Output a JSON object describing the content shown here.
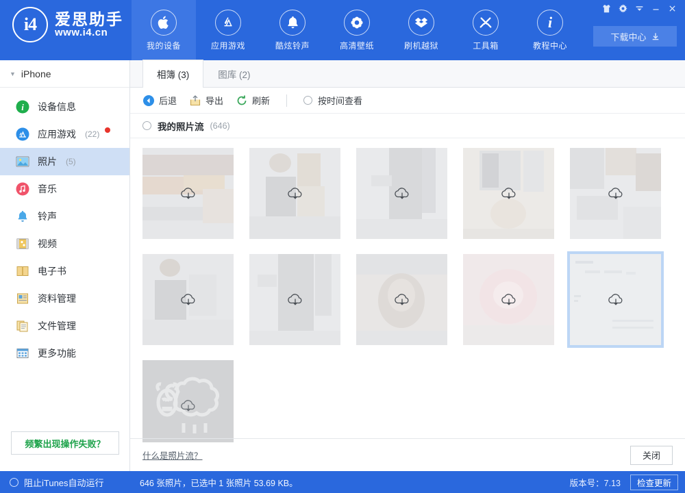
{
  "brand": {
    "name_cn": "爱思助手",
    "url": "www.i4.cn",
    "logo_text": "i4"
  },
  "topnav": {
    "items": [
      {
        "label": "我的设备",
        "icon": "apple-icon",
        "active": true
      },
      {
        "label": "应用游戏",
        "icon": "appstore-icon",
        "active": false
      },
      {
        "label": "酷炫铃声",
        "icon": "bell-icon",
        "active": false
      },
      {
        "label": "高清壁纸",
        "icon": "flower-icon",
        "active": false
      },
      {
        "label": "刷机越狱",
        "icon": "open-box-icon",
        "active": false
      },
      {
        "label": "工具箱",
        "icon": "tools-icon",
        "active": false
      },
      {
        "label": "教程中心",
        "icon": "info-icon",
        "active": false
      }
    ],
    "download_center": "下载中心",
    "window_controls": [
      "shirt-icon",
      "gear-icon",
      "menu-icon",
      "minimize-icon",
      "close-icon"
    ]
  },
  "sidebar": {
    "device": "iPhone",
    "items": [
      {
        "label": "设备信息",
        "count": "",
        "icon": "info-circle-icon",
        "active": false,
        "badge": false
      },
      {
        "label": "应用游戏",
        "count": "(22)",
        "icon": "appstore-circle-icon",
        "active": false,
        "badge": true
      },
      {
        "label": "照片",
        "count": "(5)",
        "icon": "photo-icon",
        "active": true,
        "badge": false
      },
      {
        "label": "音乐",
        "count": "",
        "icon": "music-icon",
        "active": false,
        "badge": false
      },
      {
        "label": "铃声",
        "count": "",
        "icon": "ringtone-bell-icon",
        "active": false,
        "badge": false
      },
      {
        "label": "视频",
        "count": "",
        "icon": "film-icon",
        "active": false,
        "badge": false
      },
      {
        "label": "电子书",
        "count": "",
        "icon": "book-icon",
        "active": false,
        "badge": false
      },
      {
        "label": "资料管理",
        "count": "",
        "icon": "contacts-icon",
        "active": false,
        "badge": false
      },
      {
        "label": "文件管理",
        "count": "",
        "icon": "files-icon",
        "active": false,
        "badge": false
      },
      {
        "label": "更多功能",
        "count": "",
        "icon": "grid-more-icon",
        "active": false,
        "badge": false
      }
    ],
    "help_button": "频繁出现操作失败？",
    "itunes_toggle": "阻止iTunes自动运行"
  },
  "main": {
    "tabs": [
      {
        "label": "相簿 (3)",
        "active": true
      },
      {
        "label": "图库 (2)",
        "active": false
      }
    ],
    "toolbar": {
      "back": "后退",
      "export": "导出",
      "refresh": "刷新",
      "view_by_time": "按时间查看"
    },
    "stream": {
      "title": "我的照片流",
      "count": "(646)"
    },
    "photos": [
      {
        "id": 1,
        "selected": false,
        "art": "scene-market"
      },
      {
        "id": 2,
        "selected": false,
        "art": "scene-people"
      },
      {
        "id": 3,
        "selected": false,
        "art": "scene-dress"
      },
      {
        "id": 4,
        "selected": false,
        "art": "scene-window"
      },
      {
        "id": 5,
        "selected": false,
        "art": "scene-desk"
      },
      {
        "id": 6,
        "selected": false,
        "art": "scene-portrait"
      },
      {
        "id": 7,
        "selected": false,
        "art": "scene-standing"
      },
      {
        "id": 8,
        "selected": false,
        "art": "scene-face"
      },
      {
        "id": 9,
        "selected": false,
        "art": "scene-flower"
      },
      {
        "id": 10,
        "selected": true,
        "art": "scene-document"
      },
      {
        "id": 11,
        "selected": false,
        "art": "scene-sheep"
      }
    ],
    "footer": {
      "link": "什么是照片流？",
      "close": "关闭"
    }
  },
  "statusbar": {
    "info": "646 张照片，已选中 1 张照片 53.69 KB。",
    "version": "版本号：7.13",
    "check_update": "检查更新"
  },
  "colors": {
    "header_blue": "#2a68dd",
    "nav_active_blue": "#3d77e4",
    "sidebar_active": "#cfdff5",
    "selection_border": "#bcd6f5",
    "badge_red": "#e8352c",
    "help_green": "#1ea34b"
  }
}
